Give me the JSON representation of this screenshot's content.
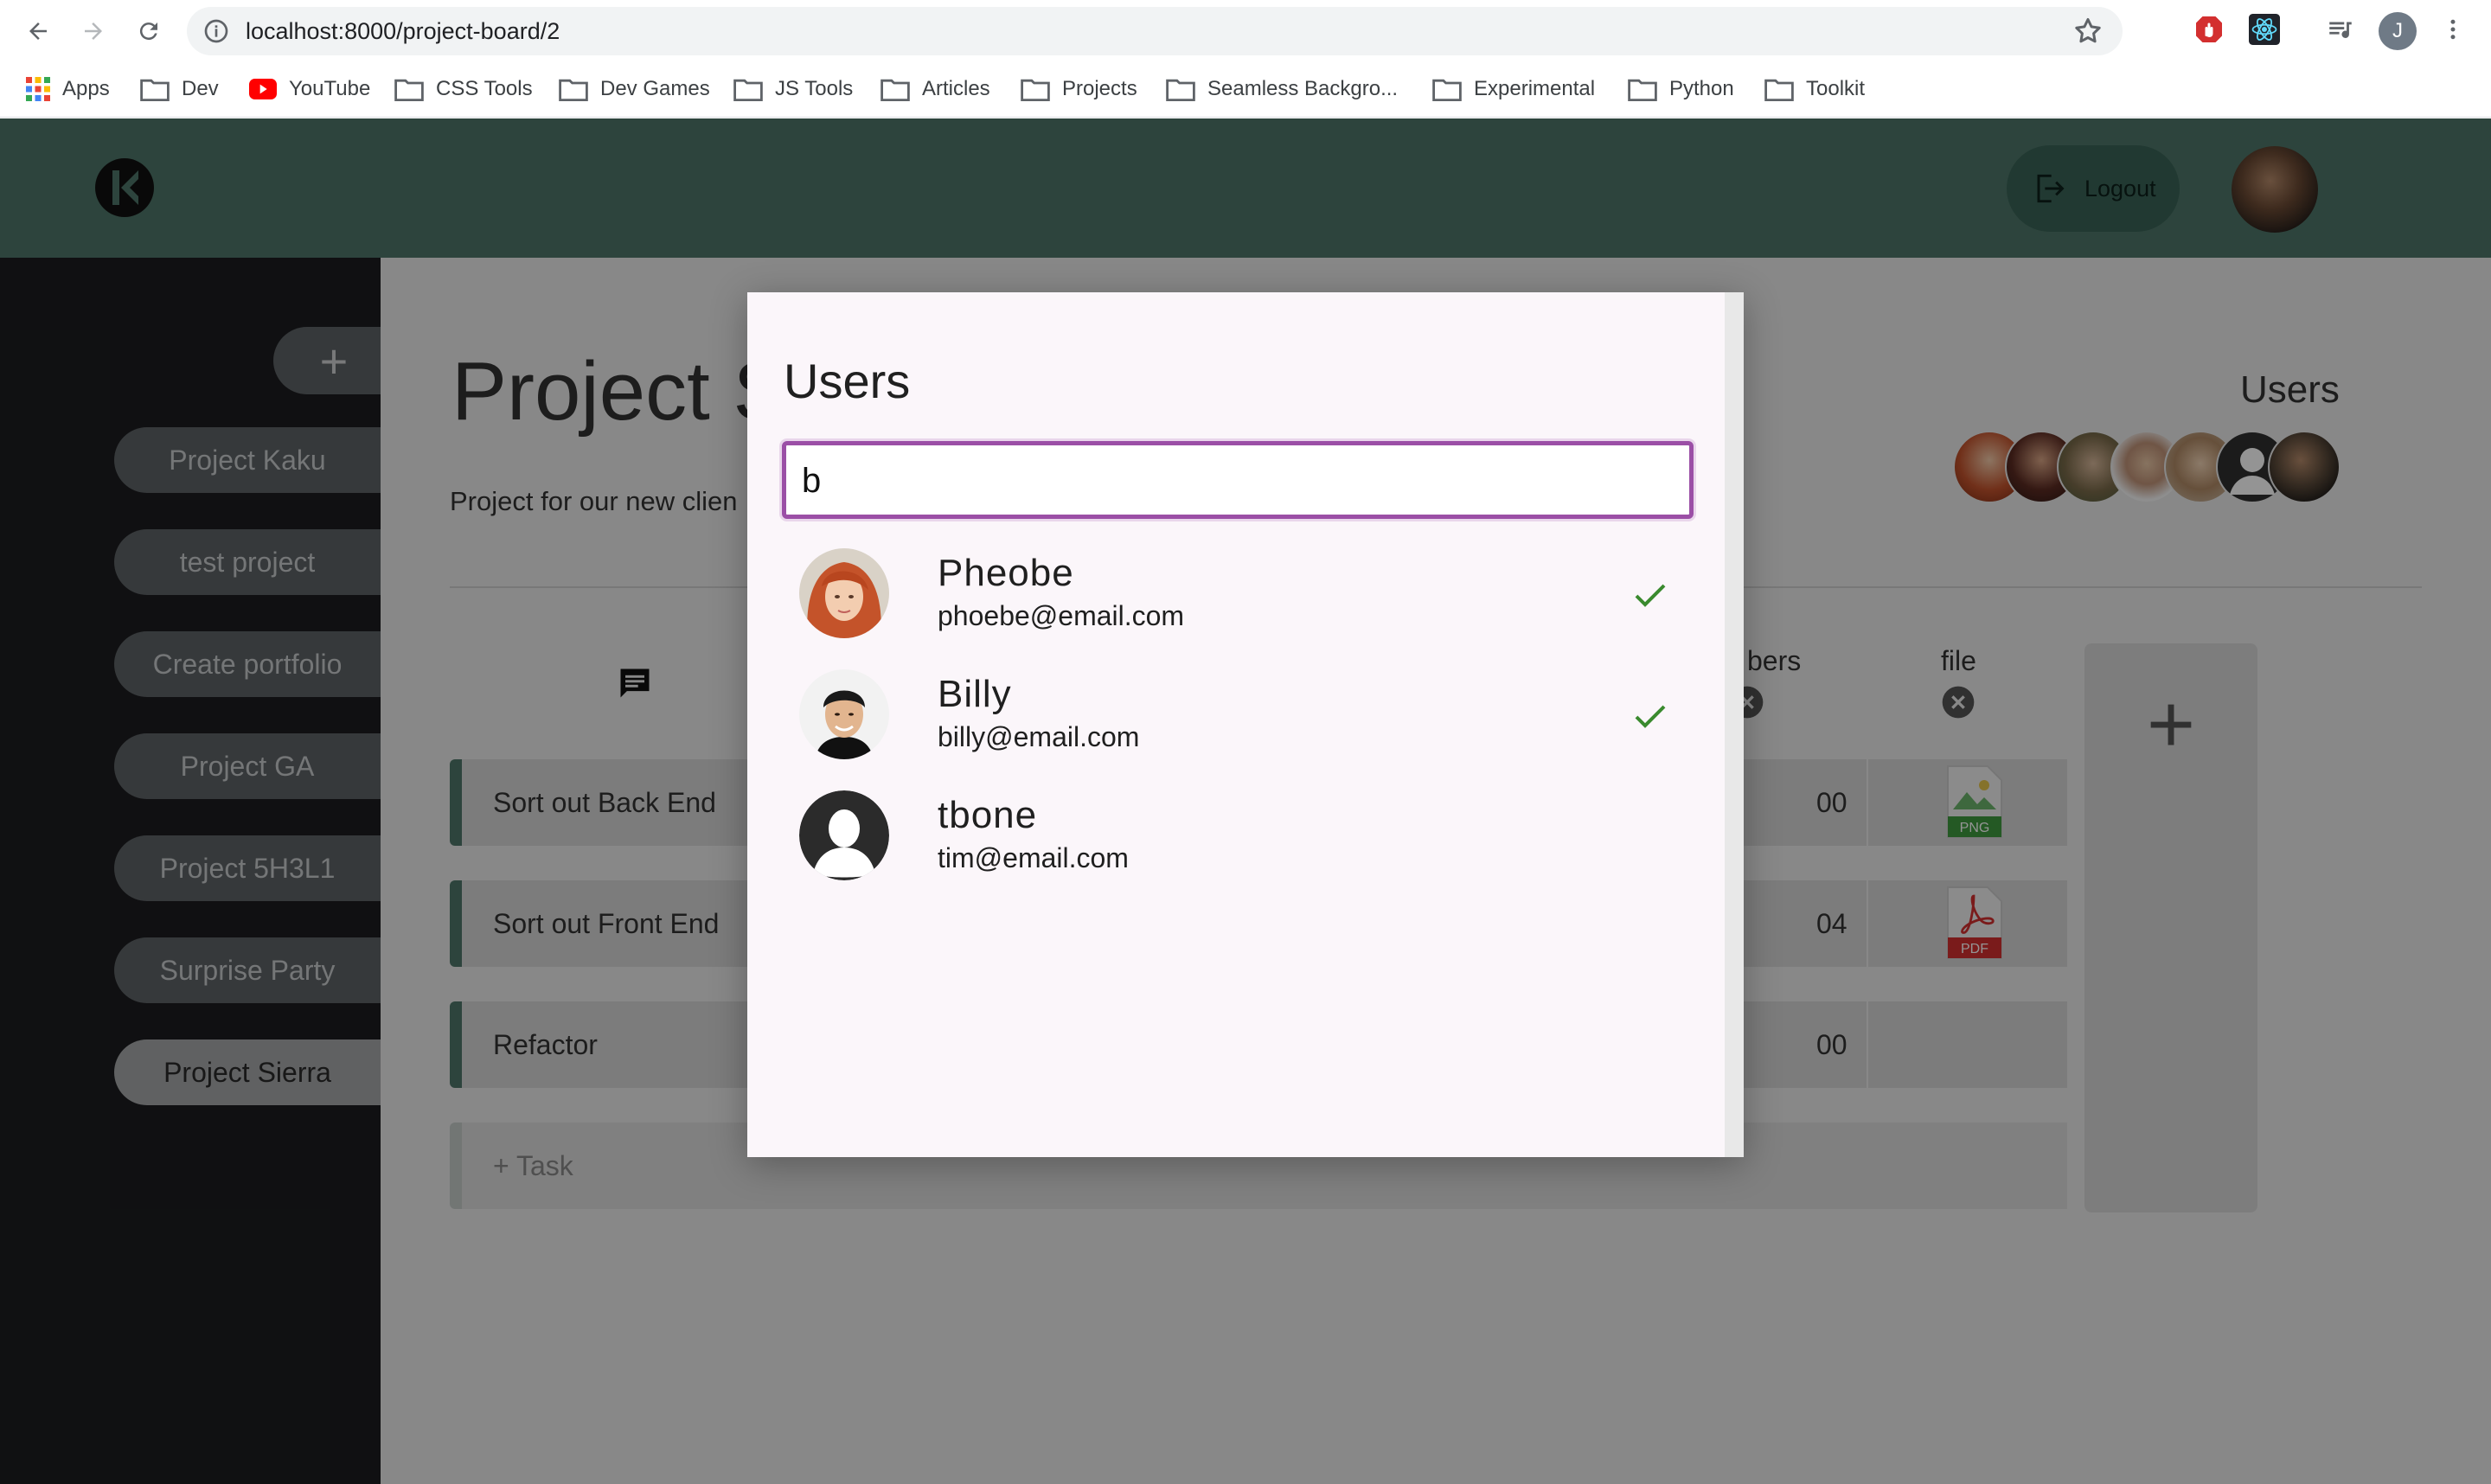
{
  "browser": {
    "url": "localhost:8000/project-board/2",
    "profile_initial": "J",
    "bookmarks": [
      {
        "label": "Apps",
        "icon": "apps-grid-icon"
      },
      {
        "label": "Dev",
        "icon": "folder-icon"
      },
      {
        "label": "YouTube",
        "icon": "youtube-icon"
      },
      {
        "label": "CSS Tools",
        "icon": "folder-icon"
      },
      {
        "label": "Dev Games",
        "icon": "folder-icon"
      },
      {
        "label": "JS Tools",
        "icon": "folder-icon"
      },
      {
        "label": "Articles",
        "icon": "folder-icon"
      },
      {
        "label": "Projects",
        "icon": "folder-icon"
      },
      {
        "label": "Seamless Backgro...",
        "icon": "folder-icon"
      },
      {
        "label": "Experimental",
        "icon": "folder-icon"
      },
      {
        "label": "Python",
        "icon": "folder-icon"
      },
      {
        "label": "Toolkit",
        "icon": "folder-icon"
      }
    ]
  },
  "header": {
    "logout_label": "Logout"
  },
  "sidebar": {
    "add_label": "+",
    "projects": [
      {
        "label": "Project Kaku",
        "active": false
      },
      {
        "label": "test project",
        "active": false
      },
      {
        "label": "Create portfolio",
        "active": false
      },
      {
        "label": "Project GA",
        "active": false
      },
      {
        "label": "Project 5H3L1",
        "active": false
      },
      {
        "label": "Surprise Party",
        "active": false
      },
      {
        "label": "Project Sierra",
        "active": true
      }
    ]
  },
  "main": {
    "title": "Project S",
    "description": "Project for our new clien",
    "users_heading": "Users",
    "columns": {
      "members_partial": "bers",
      "file": "file"
    },
    "add_column_label": "+",
    "tasks": [
      {
        "name": "Sort out Back End",
        "num": "00",
        "file": "PNG"
      },
      {
        "name": "Sort out Front End",
        "num": "04",
        "file": "PDF"
      },
      {
        "name": "Refactor",
        "num": "00",
        "file": ""
      }
    ],
    "add_task_label": "+ Task"
  },
  "dialog": {
    "title": "Users",
    "search_value": "b",
    "users": [
      {
        "name": "Pheobe",
        "email": "phoebe@email.com",
        "selected": true
      },
      {
        "name": "Billy",
        "email": "billy@email.com",
        "selected": true
      },
      {
        "name": "tbone",
        "email": "tim@email.com",
        "selected": false
      }
    ]
  },
  "colors": {
    "appbar": "#4f7669",
    "sidebar": "#1c1d1f",
    "search_focus": "#9b4fa6",
    "check": "#3a8a2e"
  }
}
